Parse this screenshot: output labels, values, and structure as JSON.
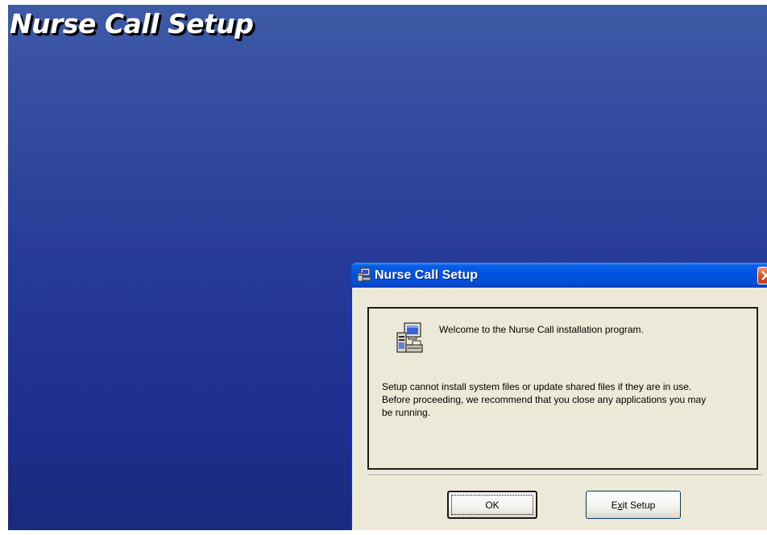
{
  "desktop": {
    "title": "Nurse Call Setup"
  },
  "dialog": {
    "title": "Nurse Call Setup",
    "close_glyph": "×",
    "welcome": "Welcome to the Nurse Call installation program.",
    "message_lines": [
      "Setup cannot install system files or update shared files if they are in use.",
      "Before proceeding, we recommend that you close any applications you may",
      "be running."
    ],
    "ok_label": "OK",
    "exit_label_pre": "E",
    "exit_label_accel": "x",
    "exit_label_post": "it Setup"
  },
  "colors": {
    "desktop_top": "#3e5aa6",
    "desktop_bottom": "#1a2a7c",
    "titlebar": "#0054e3",
    "dialog_face": "#ece9d8",
    "close_button": "#e1521f"
  },
  "icons": {
    "titlebar": "setup-computer-icon",
    "content": "setup-computer-icon",
    "close": "close-icon"
  }
}
